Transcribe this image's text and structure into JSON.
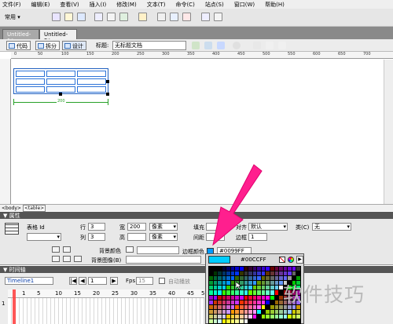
{
  "menu": [
    "文件(F)",
    "编辑(E)",
    "查看(V)",
    "插入(I)",
    "修改(M)",
    "文本(T)",
    "命令(C)",
    "站点(S)",
    "窗口(W)",
    "帮助(H)"
  ],
  "insert_bar": {
    "category": "常用"
  },
  "tabs": [
    "Untitled-1*",
    "Untitled-2*"
  ],
  "doc_toolbar": {
    "code_label": "代码",
    "split_label": "拆分",
    "design_label": "设计",
    "title_label": "标题:",
    "title_value": "无标题文档"
  },
  "ruler": {
    "marks": [
      "0",
      "50",
      "100",
      "150",
      "200",
      "250",
      "300",
      "350",
      "400",
      "450",
      "500",
      "550",
      "600",
      "650",
      "700"
    ]
  },
  "table_width_label": "200",
  "status": {
    "body_tag": "<body>",
    "table_tag": "<table>"
  },
  "properties": {
    "header": "属性",
    "table_id_label": "表格 Id",
    "rows_label": "行",
    "rows_value": "3",
    "cols_label": "列",
    "cols_value": "3",
    "width_label": "宽",
    "width_value": "200",
    "width_unit": "像素",
    "height_label": "高",
    "height_unit": "像素",
    "padding_label": "填充",
    "spacing_label": "间距",
    "align_label": "对齐",
    "align_value": "默认",
    "border_label": "边框",
    "border_value": "1",
    "class_label": "类(C)",
    "class_value": "无",
    "bgcolor_label": "背景颜色",
    "border_color_label": "边框颜色",
    "border_color_value": "#0099FF",
    "bgimage_label": "背景图像(B)"
  },
  "timeline": {
    "header": "时间轴",
    "name": "Timeline1",
    "frame": "1",
    "fps_label": "Fps",
    "fps_value": "15",
    "autoplay_label": "自动播放",
    "frame_marks": [
      "1",
      "5",
      "10",
      "15",
      "20",
      "25",
      "30",
      "35",
      "40",
      "45",
      "50"
    ],
    "track_first": "1"
  },
  "color_picker": {
    "hex": "#00CCFF",
    "preview_color": "#00ccff"
  },
  "colors": {
    "accent_pink": "#ff1f8e",
    "border_blue": "#0099ff"
  },
  "watermark": "软件技巧"
}
